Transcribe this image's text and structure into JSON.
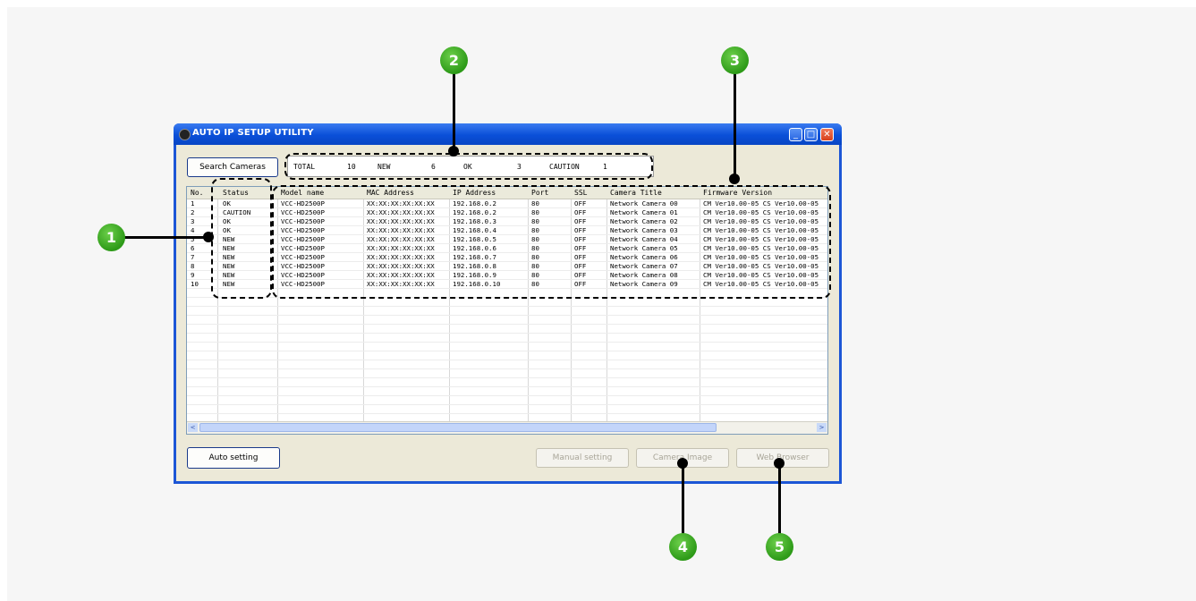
{
  "window": {
    "title": "AUTO IP SETUP UTILITY",
    "minimize_glyph": "_",
    "maximize_glyph": "□",
    "close_glyph": "✕"
  },
  "toolbar": {
    "search_label": "Search Cameras",
    "auto_setting_label": "Auto setting",
    "manual_setting_label": "Manual setting",
    "camera_image_label": "Camera Image",
    "web_browser_label": "Web Browser"
  },
  "summary": {
    "total_label": "TOTAL",
    "total_value": "10",
    "new_label": "NEW",
    "new_value": "6",
    "ok_label": "OK",
    "ok_value": "3",
    "caution_label": "CAUTION",
    "caution_value": "1"
  },
  "table": {
    "columns": [
      "No.",
      "Status",
      "Model name",
      "MAC Address",
      "IP Address",
      "Port",
      "SSL",
      "Camera Title",
      "Firmware Version"
    ],
    "rows": [
      [
        "1",
        "OK",
        "VCC-HD2500P",
        "XX:XX:XX:XX:XX:XX",
        "192.168.0.2",
        "80",
        "OFF",
        "Network Camera 00",
        "CM Ver10.00-05 CS Ver10.00-05"
      ],
      [
        "2",
        "CAUTION",
        "VCC-HD2500P",
        "XX:XX:XX:XX:XX:XX",
        "192.168.0.2",
        "80",
        "OFF",
        "Network Camera 01",
        "CM Ver10.00-05 CS Ver10.00-05"
      ],
      [
        "3",
        "OK",
        "VCC-HD2500P",
        "XX:XX:XX:XX:XX:XX",
        "192.168.0.3",
        "80",
        "OFF",
        "Network Camera 02",
        "CM Ver10.00-05 CS Ver10.00-05"
      ],
      [
        "4",
        "OK",
        "VCC-HD2500P",
        "XX:XX:XX:XX:XX:XX",
        "192.168.0.4",
        "80",
        "OFF",
        "Network Camera 03",
        "CM Ver10.00-05 CS Ver10.00-05"
      ],
      [
        "5",
        "NEW",
        "VCC-HD2500P",
        "XX:XX:XX:XX:XX:XX",
        "192.168.0.5",
        "80",
        "OFF",
        "Network Camera 04",
        "CM Ver10.00-05 CS Ver10.00-05"
      ],
      [
        "6",
        "NEW",
        "VCC-HD2500P",
        "XX:XX:XX:XX:XX:XX",
        "192.168.0.6",
        "80",
        "OFF",
        "Network Camera 05",
        "CM Ver10.00-05 CS Ver10.00-05"
      ],
      [
        "7",
        "NEW",
        "VCC-HD2500P",
        "XX:XX:XX:XX:XX:XX",
        "192.168.0.7",
        "80",
        "OFF",
        "Network Camera 06",
        "CM Ver10.00-05 CS Ver10.00-05"
      ],
      [
        "8",
        "NEW",
        "VCC-HD2500P",
        "XX:XX:XX:XX:XX:XX",
        "192.168.0.8",
        "80",
        "OFF",
        "Network Camera 07",
        "CM Ver10.00-05 CS Ver10.00-05"
      ],
      [
        "9",
        "NEW",
        "VCC-HD2500P",
        "XX:XX:XX:XX:XX:XX",
        "192.168.0.9",
        "80",
        "OFF",
        "Network Camera 08",
        "CM Ver10.00-05 CS Ver10.00-05"
      ],
      [
        "10",
        "NEW",
        "VCC-HD2500P",
        "XX:XX:XX:XX:XX:XX",
        "192.168.0.10",
        "80",
        "OFF",
        "Network Camera 09",
        "CM Ver10.00-05 CS Ver10.00-05"
      ]
    ]
  },
  "scrollbar": {
    "left_arrow": "<",
    "right_arrow": ">"
  },
  "callouts": [
    "1",
    "2",
    "3",
    "4",
    "5"
  ]
}
